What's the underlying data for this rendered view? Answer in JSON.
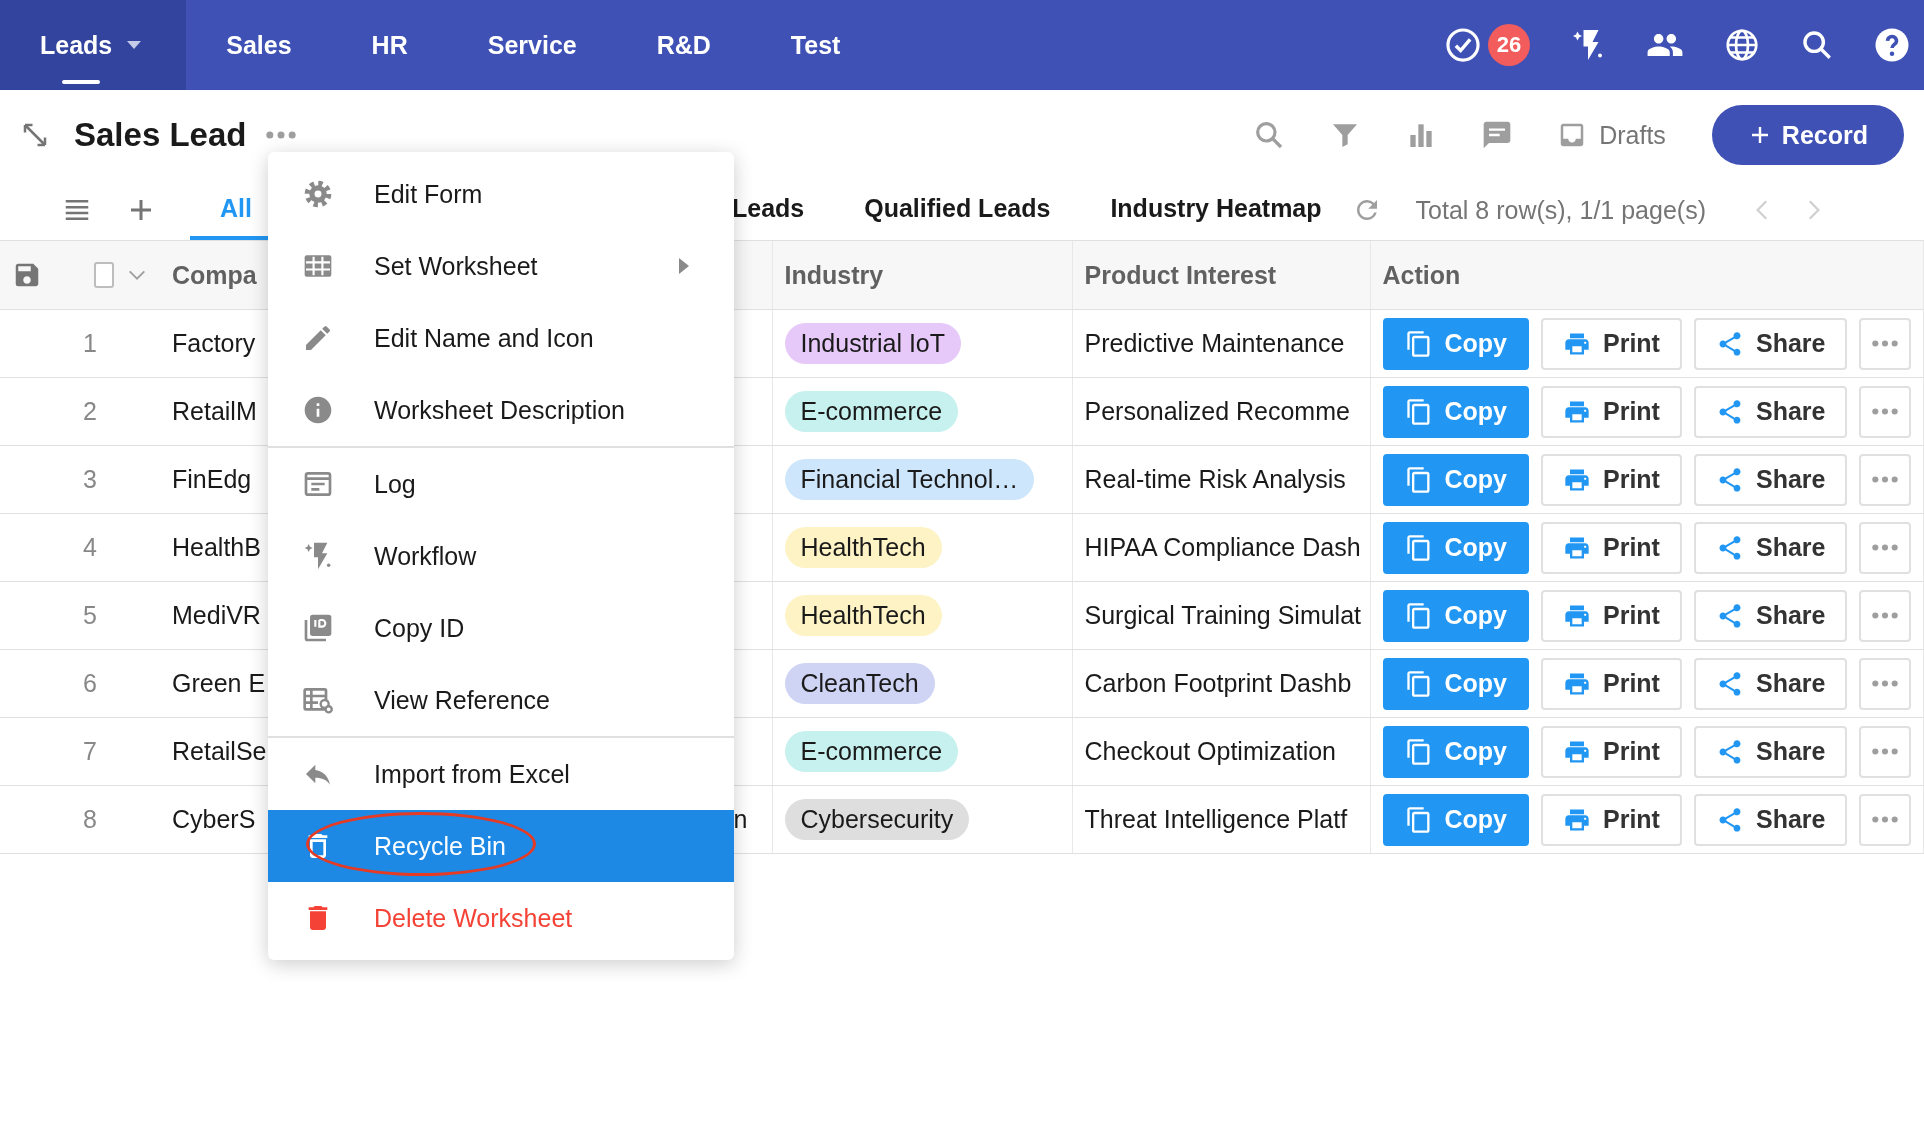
{
  "nav": {
    "items": [
      {
        "label": "Leads",
        "selected": true,
        "dropdown": true
      },
      {
        "label": "Sales",
        "selected": false,
        "dropdown": false
      },
      {
        "label": "HR",
        "selected": false,
        "dropdown": false
      },
      {
        "label": "Service",
        "selected": false,
        "dropdown": false
      },
      {
        "label": "R&D",
        "selected": false,
        "dropdown": false
      },
      {
        "label": "Test",
        "selected": false,
        "dropdown": false
      }
    ],
    "task_badge": "26"
  },
  "header": {
    "title": "Sales Lead",
    "drafts": "Drafts",
    "record_button": "Record"
  },
  "views": {
    "tabs": [
      {
        "label": "All",
        "selected": true
      },
      {
        "label": "Leads",
        "selected": false
      },
      {
        "label": "Qualified Leads",
        "selected": false
      },
      {
        "label": "Industry Heatmap",
        "selected": false
      }
    ],
    "summary": "Total 8 row(s), 1/1 page(s)"
  },
  "table": {
    "select_all": {
      "checked": false
    },
    "columns": [
      "Compa",
      "",
      "Industry",
      "Product Interest",
      "Action"
    ],
    "rows": [
      {
        "number": "1",
        "company": "Factory",
        "column_3": "",
        "industry": {
          "label": "Industrial IoT",
          "color": "#e6c9f8"
        },
        "product": "Predictive Maintenance",
        "actions": [
          "Copy",
          "Print",
          "Share"
        ]
      },
      {
        "number": "2",
        "company": "RetailM",
        "column_3": "",
        "industry": {
          "label": "E-commerce",
          "color": "#c6f1ee"
        },
        "product": "Personalized Recomme",
        "actions": [
          "Copy",
          "Print",
          "Share"
        ]
      },
      {
        "number": "3",
        "company": "FinEdg",
        "column_3": "",
        "industry": {
          "label": "Financial Technol…",
          "color": "#cde6fb"
        },
        "product": "Real-time Risk Analysis",
        "actions": [
          "Copy",
          "Print",
          "Share"
        ]
      },
      {
        "number": "4",
        "company": "HealthB",
        "column_3": "",
        "industry": {
          "label": "HealthTech",
          "color": "#fdf3c5"
        },
        "product": "HIPAA Compliance Dash",
        "actions": [
          "Copy",
          "Print",
          "Share"
        ]
      },
      {
        "number": "5",
        "company": "MediVR",
        "column_3": "",
        "industry": {
          "label": "HealthTech",
          "color": "#fdf3c5"
        },
        "product": "Surgical Training Simulat",
        "actions": [
          "Copy",
          "Print",
          "Share"
        ]
      },
      {
        "number": "6",
        "company": "Green E",
        "column_3": "",
        "industry": {
          "label": "CleanTech",
          "color": "#cfd3f4"
        },
        "product": "Carbon Footprint Dashb",
        "actions": [
          "Copy",
          "Print",
          "Share"
        ]
      },
      {
        "number": "7",
        "company": "RetailSe",
        "column_3": "",
        "industry": {
          "label": "E-commerce",
          "color": "#c6f1ee"
        },
        "product": "Checkout Optimization",
        "actions": [
          "Copy",
          "Print",
          "Share"
        ]
      },
      {
        "number": "8",
        "company": "CyberS",
        "column_3": "n",
        "industry": {
          "label": "Cybersecurity",
          "color": "#dedede"
        },
        "product": "Threat Intelligence Platf",
        "actions": [
          "Copy",
          "Print",
          "Share"
        ]
      }
    ]
  },
  "menu": {
    "sections": [
      [
        {
          "label": "Edit Form",
          "selected": false,
          "submenu": false,
          "destructive": false
        },
        {
          "label": "Set Worksheet",
          "selected": false,
          "submenu": true,
          "destructive": false
        },
        {
          "label": "Edit Name and Icon",
          "selected": false,
          "submenu": false,
          "destructive": false
        },
        {
          "label": "Worksheet Description",
          "selected": false,
          "submenu": false,
          "destructive": false
        }
      ],
      [
        {
          "label": "Log",
          "selected": false,
          "submenu": false,
          "destructive": false
        },
        {
          "label": "Workflow",
          "selected": false,
          "submenu": false,
          "destructive": false
        },
        {
          "label": "Copy ID",
          "selected": false,
          "submenu": false,
          "destructive": false
        },
        {
          "label": "View Reference",
          "selected": false,
          "submenu": false,
          "destructive": false
        }
      ],
      [
        {
          "label": "Import from Excel",
          "selected": false,
          "submenu": false,
          "destructive": false
        },
        {
          "label": "Recycle Bin",
          "selected": true,
          "submenu": false,
          "destructive": false,
          "circled": true
        },
        {
          "label": "Delete Worksheet",
          "selected": false,
          "submenu": false,
          "destructive": true
        }
      ]
    ]
  }
}
